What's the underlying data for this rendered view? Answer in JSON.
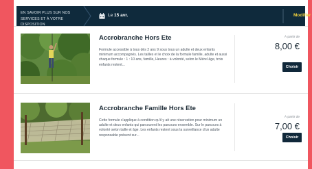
{
  "header": {
    "breadcrumb": "En savoir plus sur nos services et à votre disposition",
    "date_prefix": "Le",
    "date_value": "15 avr.",
    "modify_label": "Modifier",
    "accent_color": "#f3d23d",
    "bar_color": "#0f2a3c",
    "icons": [
      "calendar-icon",
      "chevron-right-icon"
    ]
  },
  "offers": [
    {
      "title": "Accrobranche Hors Ete",
      "description": "Formule accessible à tous dès 2 ans 9 sous tous un adulte et deux enfants minimum accompagnés. Les tailles et le choix de la formule famille, adulte et aussi chaque formule : 1 : 10 ans, famille, Heures : à volonté, selon le Mérel âge, trois enfants restent...",
      "from_label": "À partir de",
      "price": "8,00 €",
      "choose_label": "Choisir",
      "image": "man-on-zipline-in-tree-photo"
    },
    {
      "title": "Accrobranche Famille Hors Ete",
      "description": "Cette formule s'applique à condition qu'il y ait une réservation pour minimum un adulte et deux enfants qui parcourent les parcours ensemble. Sur le parcours à volonté selon taille et âge. Les enfants restent sous la surveillance d'un adulte responsable présent sur...",
      "from_label": "À partir de",
      "price": "7,00 €",
      "choose_label": "Choisir",
      "image": "rope-net-in-forest-photo"
    }
  ],
  "background_color": "#f0565f"
}
